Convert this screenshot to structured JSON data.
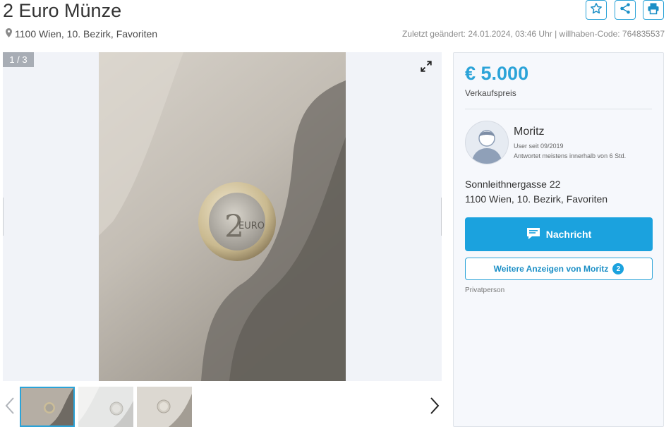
{
  "header": {
    "title": "2 Euro Münze",
    "location": "1100 Wien, 10. Bezirk, Favoriten",
    "meta": "Zuletzt geändert: 24.01.2024, 03:46 Uhr | willhaben-Code: 764835537",
    "actions": [
      {
        "icon": "star-icon"
      },
      {
        "icon": "share-icon"
      },
      {
        "icon": "print-icon"
      }
    ]
  },
  "gallery": {
    "counter": "1 / 3",
    "thumbnails": 3,
    "active_thumbnail": 1
  },
  "sidebar": {
    "price": "€ 5.000",
    "price_label": "Verkaufspreis",
    "seller": {
      "name": "Moritz",
      "since": "User seit 09/2019",
      "response": "Antwortet meistens innerhalb von 6 Std."
    },
    "address": {
      "street": "Sonnleithnergasse 22",
      "city": "1100 Wien, 10. Bezirk, Favoriten"
    },
    "message_button": "Nachricht",
    "more_ads_button": "Weitere Anzeigen von Moritz",
    "more_ads_count": "2",
    "seller_type": "Privatperson"
  },
  "colors": {
    "accent": "#1ba2de",
    "price": "#2ba3d8"
  }
}
